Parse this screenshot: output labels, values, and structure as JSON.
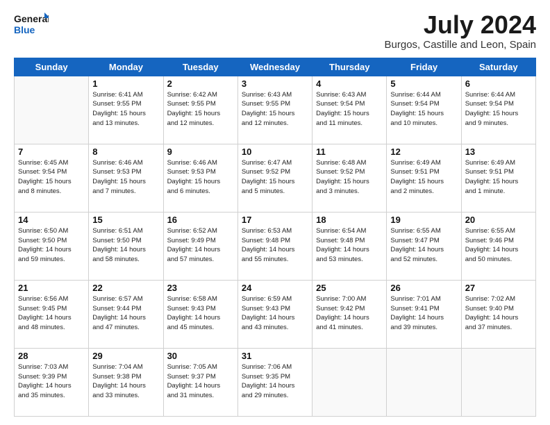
{
  "header": {
    "logo_line1": "General",
    "logo_line2": "Blue",
    "title": "July 2024",
    "subtitle": "Burgos, Castille and Leon, Spain"
  },
  "days_of_week": [
    "Sunday",
    "Monday",
    "Tuesday",
    "Wednesday",
    "Thursday",
    "Friday",
    "Saturday"
  ],
  "weeks": [
    [
      {
        "day": "",
        "info": ""
      },
      {
        "day": "1",
        "info": "Sunrise: 6:41 AM\nSunset: 9:55 PM\nDaylight: 15 hours\nand 13 minutes."
      },
      {
        "day": "2",
        "info": "Sunrise: 6:42 AM\nSunset: 9:55 PM\nDaylight: 15 hours\nand 12 minutes."
      },
      {
        "day": "3",
        "info": "Sunrise: 6:43 AM\nSunset: 9:55 PM\nDaylight: 15 hours\nand 12 minutes."
      },
      {
        "day": "4",
        "info": "Sunrise: 6:43 AM\nSunset: 9:54 PM\nDaylight: 15 hours\nand 11 minutes."
      },
      {
        "day": "5",
        "info": "Sunrise: 6:44 AM\nSunset: 9:54 PM\nDaylight: 15 hours\nand 10 minutes."
      },
      {
        "day": "6",
        "info": "Sunrise: 6:44 AM\nSunset: 9:54 PM\nDaylight: 15 hours\nand 9 minutes."
      }
    ],
    [
      {
        "day": "7",
        "info": "Sunrise: 6:45 AM\nSunset: 9:54 PM\nDaylight: 15 hours\nand 8 minutes."
      },
      {
        "day": "8",
        "info": "Sunrise: 6:46 AM\nSunset: 9:53 PM\nDaylight: 15 hours\nand 7 minutes."
      },
      {
        "day": "9",
        "info": "Sunrise: 6:46 AM\nSunset: 9:53 PM\nDaylight: 15 hours\nand 6 minutes."
      },
      {
        "day": "10",
        "info": "Sunrise: 6:47 AM\nSunset: 9:52 PM\nDaylight: 15 hours\nand 5 minutes."
      },
      {
        "day": "11",
        "info": "Sunrise: 6:48 AM\nSunset: 9:52 PM\nDaylight: 15 hours\nand 3 minutes."
      },
      {
        "day": "12",
        "info": "Sunrise: 6:49 AM\nSunset: 9:51 PM\nDaylight: 15 hours\nand 2 minutes."
      },
      {
        "day": "13",
        "info": "Sunrise: 6:49 AM\nSunset: 9:51 PM\nDaylight: 15 hours\nand 1 minute."
      }
    ],
    [
      {
        "day": "14",
        "info": "Sunrise: 6:50 AM\nSunset: 9:50 PM\nDaylight: 14 hours\nand 59 minutes."
      },
      {
        "day": "15",
        "info": "Sunrise: 6:51 AM\nSunset: 9:50 PM\nDaylight: 14 hours\nand 58 minutes."
      },
      {
        "day": "16",
        "info": "Sunrise: 6:52 AM\nSunset: 9:49 PM\nDaylight: 14 hours\nand 57 minutes."
      },
      {
        "day": "17",
        "info": "Sunrise: 6:53 AM\nSunset: 9:48 PM\nDaylight: 14 hours\nand 55 minutes."
      },
      {
        "day": "18",
        "info": "Sunrise: 6:54 AM\nSunset: 9:48 PM\nDaylight: 14 hours\nand 53 minutes."
      },
      {
        "day": "19",
        "info": "Sunrise: 6:55 AM\nSunset: 9:47 PM\nDaylight: 14 hours\nand 52 minutes."
      },
      {
        "day": "20",
        "info": "Sunrise: 6:55 AM\nSunset: 9:46 PM\nDaylight: 14 hours\nand 50 minutes."
      }
    ],
    [
      {
        "day": "21",
        "info": "Sunrise: 6:56 AM\nSunset: 9:45 PM\nDaylight: 14 hours\nand 48 minutes."
      },
      {
        "day": "22",
        "info": "Sunrise: 6:57 AM\nSunset: 9:44 PM\nDaylight: 14 hours\nand 47 minutes."
      },
      {
        "day": "23",
        "info": "Sunrise: 6:58 AM\nSunset: 9:43 PM\nDaylight: 14 hours\nand 45 minutes."
      },
      {
        "day": "24",
        "info": "Sunrise: 6:59 AM\nSunset: 9:43 PM\nDaylight: 14 hours\nand 43 minutes."
      },
      {
        "day": "25",
        "info": "Sunrise: 7:00 AM\nSunset: 9:42 PM\nDaylight: 14 hours\nand 41 minutes."
      },
      {
        "day": "26",
        "info": "Sunrise: 7:01 AM\nSunset: 9:41 PM\nDaylight: 14 hours\nand 39 minutes."
      },
      {
        "day": "27",
        "info": "Sunrise: 7:02 AM\nSunset: 9:40 PM\nDaylight: 14 hours\nand 37 minutes."
      }
    ],
    [
      {
        "day": "28",
        "info": "Sunrise: 7:03 AM\nSunset: 9:39 PM\nDaylight: 14 hours\nand 35 minutes."
      },
      {
        "day": "29",
        "info": "Sunrise: 7:04 AM\nSunset: 9:38 PM\nDaylight: 14 hours\nand 33 minutes."
      },
      {
        "day": "30",
        "info": "Sunrise: 7:05 AM\nSunset: 9:37 PM\nDaylight: 14 hours\nand 31 minutes."
      },
      {
        "day": "31",
        "info": "Sunrise: 7:06 AM\nSunset: 9:35 PM\nDaylight: 14 hours\nand 29 minutes."
      },
      {
        "day": "",
        "info": ""
      },
      {
        "day": "",
        "info": ""
      },
      {
        "day": "",
        "info": ""
      }
    ]
  ]
}
